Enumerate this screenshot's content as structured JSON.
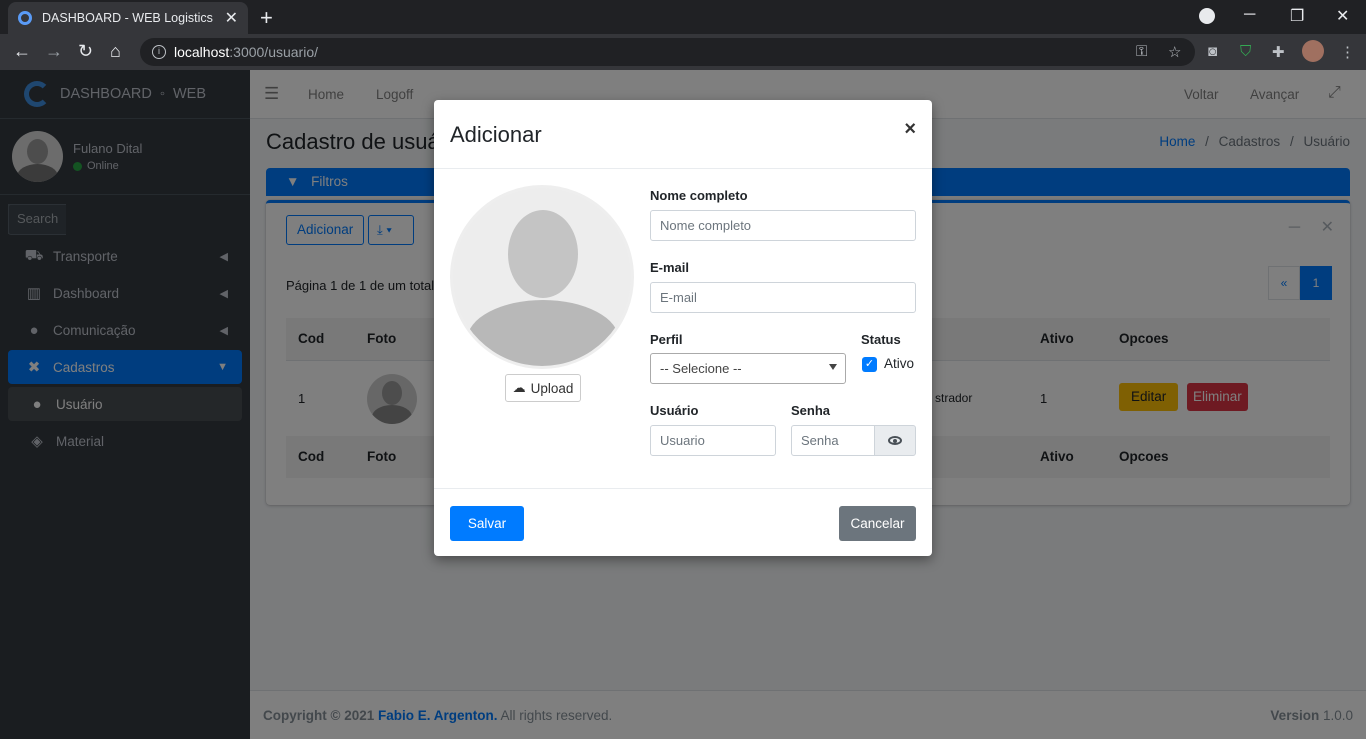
{
  "browser": {
    "tab_title": "DASHBOARD - WEB Logistics",
    "tab_close": "✕",
    "new_tab": "+",
    "url_host": "localhost",
    "url_path": ":3000/usuario/"
  },
  "sidebar": {
    "brand_a": "DASHBOARD",
    "brand_sep": "◦",
    "brand_b": "WEB",
    "user_name": "Fulano Dital",
    "user_status": "Online",
    "search_placeholder": "Search",
    "items": [
      {
        "label": "Transporte",
        "icon": "truck-icon"
      },
      {
        "label": "Dashboard",
        "icon": "chart-icon"
      },
      {
        "label": "Comunicação",
        "icon": "chat-icon"
      },
      {
        "label": "Cadastros",
        "icon": "tools-icon"
      },
      {
        "label": "Usuário",
        "icon": "user-icon"
      },
      {
        "label": "Material",
        "icon": "box-icon"
      }
    ]
  },
  "topnav": {
    "home": "Home",
    "logoff": "Logoff",
    "voltar": "Voltar",
    "avancar": "Avançar"
  },
  "content": {
    "page_title": "Cadastro de usuá",
    "breadcrumb": {
      "home": "Home",
      "sep": "/",
      "cadastros": "Cadastros",
      "usuario": "Usuário"
    },
    "filter_label": "Filtros",
    "add_label": "Adicionar",
    "pagination_info": "Página 1 de 1 de um total",
    "pager": {
      "prev": "«",
      "current": "1"
    },
    "table": {
      "headers": {
        "cod": "Cod",
        "foto": "Foto",
        "ativo": "Ativo",
        "opcoes": "Opcoes"
      },
      "rows": [
        {
          "cod": "1",
          "perfil_partial": "strador",
          "ativo": "1",
          "edit": "Editar",
          "delete": "Eliminar"
        }
      ]
    }
  },
  "footer": {
    "copyright": "Copyright © 2021",
    "author": "Fabio E. Argenton.",
    "rights": "All rights reserved.",
    "version_label": "Version",
    "version": "1.0.0"
  },
  "modal": {
    "title": "Adicionar",
    "close": "×",
    "upload": "Upload",
    "nome_label": "Nome completo",
    "nome_placeholder": "Nome completo",
    "email_label": "E-mail",
    "email_placeholder": "E-mail",
    "perfil_label": "Perfil",
    "perfil_value": "-- Selecione --",
    "status_label": "Status",
    "ativo_label": "Ativo",
    "usuario_label": "Usuário",
    "usuario_placeholder": "Usuario",
    "senha_label": "Senha",
    "senha_placeholder": "Senha",
    "save": "Salvar",
    "cancel": "Cancelar"
  },
  "colors": {
    "primary": "#007bff",
    "sidebar": "#343a40",
    "warning": "#ffc107",
    "danger": "#dc3545",
    "secondary": "#6c757d"
  }
}
